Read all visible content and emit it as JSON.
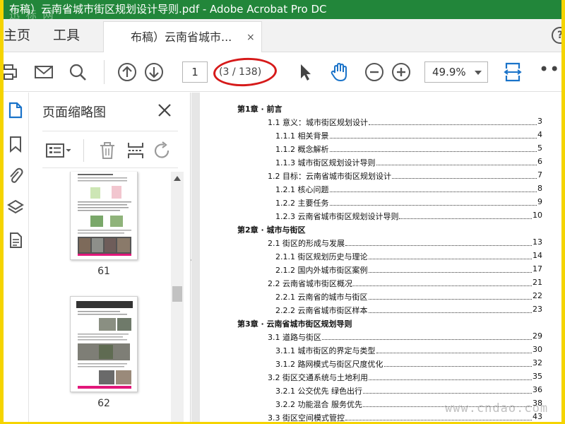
{
  "window": {
    "title": "布稿）云南省城市街区规划设计导则.pdf - Adobe Acrobat Pro DC",
    "watermark_top": "迅 标 网",
    "watermark_bottom": "www.cndao.com"
  },
  "tabs": {
    "home": "主页",
    "tools": "工具",
    "document": "布稿）云南省城市...",
    "close": "×",
    "help": "?"
  },
  "toolbar": {
    "page_current": "1",
    "page_total": "(3 / 138)",
    "zoom": "49.9%",
    "more": "•••",
    "highlight_color": "#d61a1a"
  },
  "thumbnails_panel": {
    "title": "页面缩略图",
    "pages": [
      "61",
      "62"
    ]
  },
  "toc": {
    "rows": [
      {
        "label": "第1章 · 前言",
        "page": "",
        "level": 0
      },
      {
        "label": "1.1 意义：城市街区规划设计",
        "page": "3",
        "level": 1
      },
      {
        "label": "1.1.1 相关背景",
        "page": "4",
        "level": 2
      },
      {
        "label": "1.1.2 概念解析",
        "page": "5",
        "level": 2
      },
      {
        "label": "1.1.3 城市街区规划设计导则",
        "page": "6",
        "level": 2
      },
      {
        "label": "1.2 目标：云南省城市街区规划设计",
        "page": "7",
        "level": 1
      },
      {
        "label": "1.2.1 核心问题",
        "page": "8",
        "level": 2
      },
      {
        "label": "1.2.2 主要任务",
        "page": "9",
        "level": 2
      },
      {
        "label": "1.2.3 云南省城市街区规划设计导则",
        "page": "10",
        "level": 2
      },
      {
        "label": "第2章 · 城市与街区",
        "page": "",
        "level": 0
      },
      {
        "label": "2.1 街区的形成与发展",
        "page": "13",
        "level": 1
      },
      {
        "label": "2.1.1 街区规划历史与理论",
        "page": "14",
        "level": 2
      },
      {
        "label": "2.1.2 国内外城市街区案例",
        "page": "17",
        "level": 2
      },
      {
        "label": "2.2 云南省城市街区概况",
        "page": "21",
        "level": 1
      },
      {
        "label": "2.2.1 云南省的城市与街区",
        "page": "22",
        "level": 2
      },
      {
        "label": "2.2.2 云南省城市街区样本",
        "page": "23",
        "level": 2
      },
      {
        "label": "第3章 · 云南省城市街区规划导则",
        "page": "",
        "level": 0
      },
      {
        "label": "3.1 道路与街区",
        "page": "29",
        "level": 1
      },
      {
        "label": "3.1.1 城市街区的界定与类型",
        "page": "30",
        "level": 2
      },
      {
        "label": "3.1.2 路网模式与街区尺度优化",
        "page": "32",
        "level": 2
      },
      {
        "label": "3.2 街区交通系统与土地利用",
        "page": "35",
        "level": 1
      },
      {
        "label": "3.2.1 公交优先 绿色出行",
        "page": "36",
        "level": 2
      },
      {
        "label": "3.2.2 功能混合 服务优先",
        "page": "38",
        "level": 2
      },
      {
        "label": "3.3 街区空间模式管控",
        "page": "43",
        "level": 1
      }
    ]
  },
  "colors": {
    "titlebar": "#22863a",
    "frame": "#f5d400",
    "accent_blue": "#1a73c9"
  }
}
